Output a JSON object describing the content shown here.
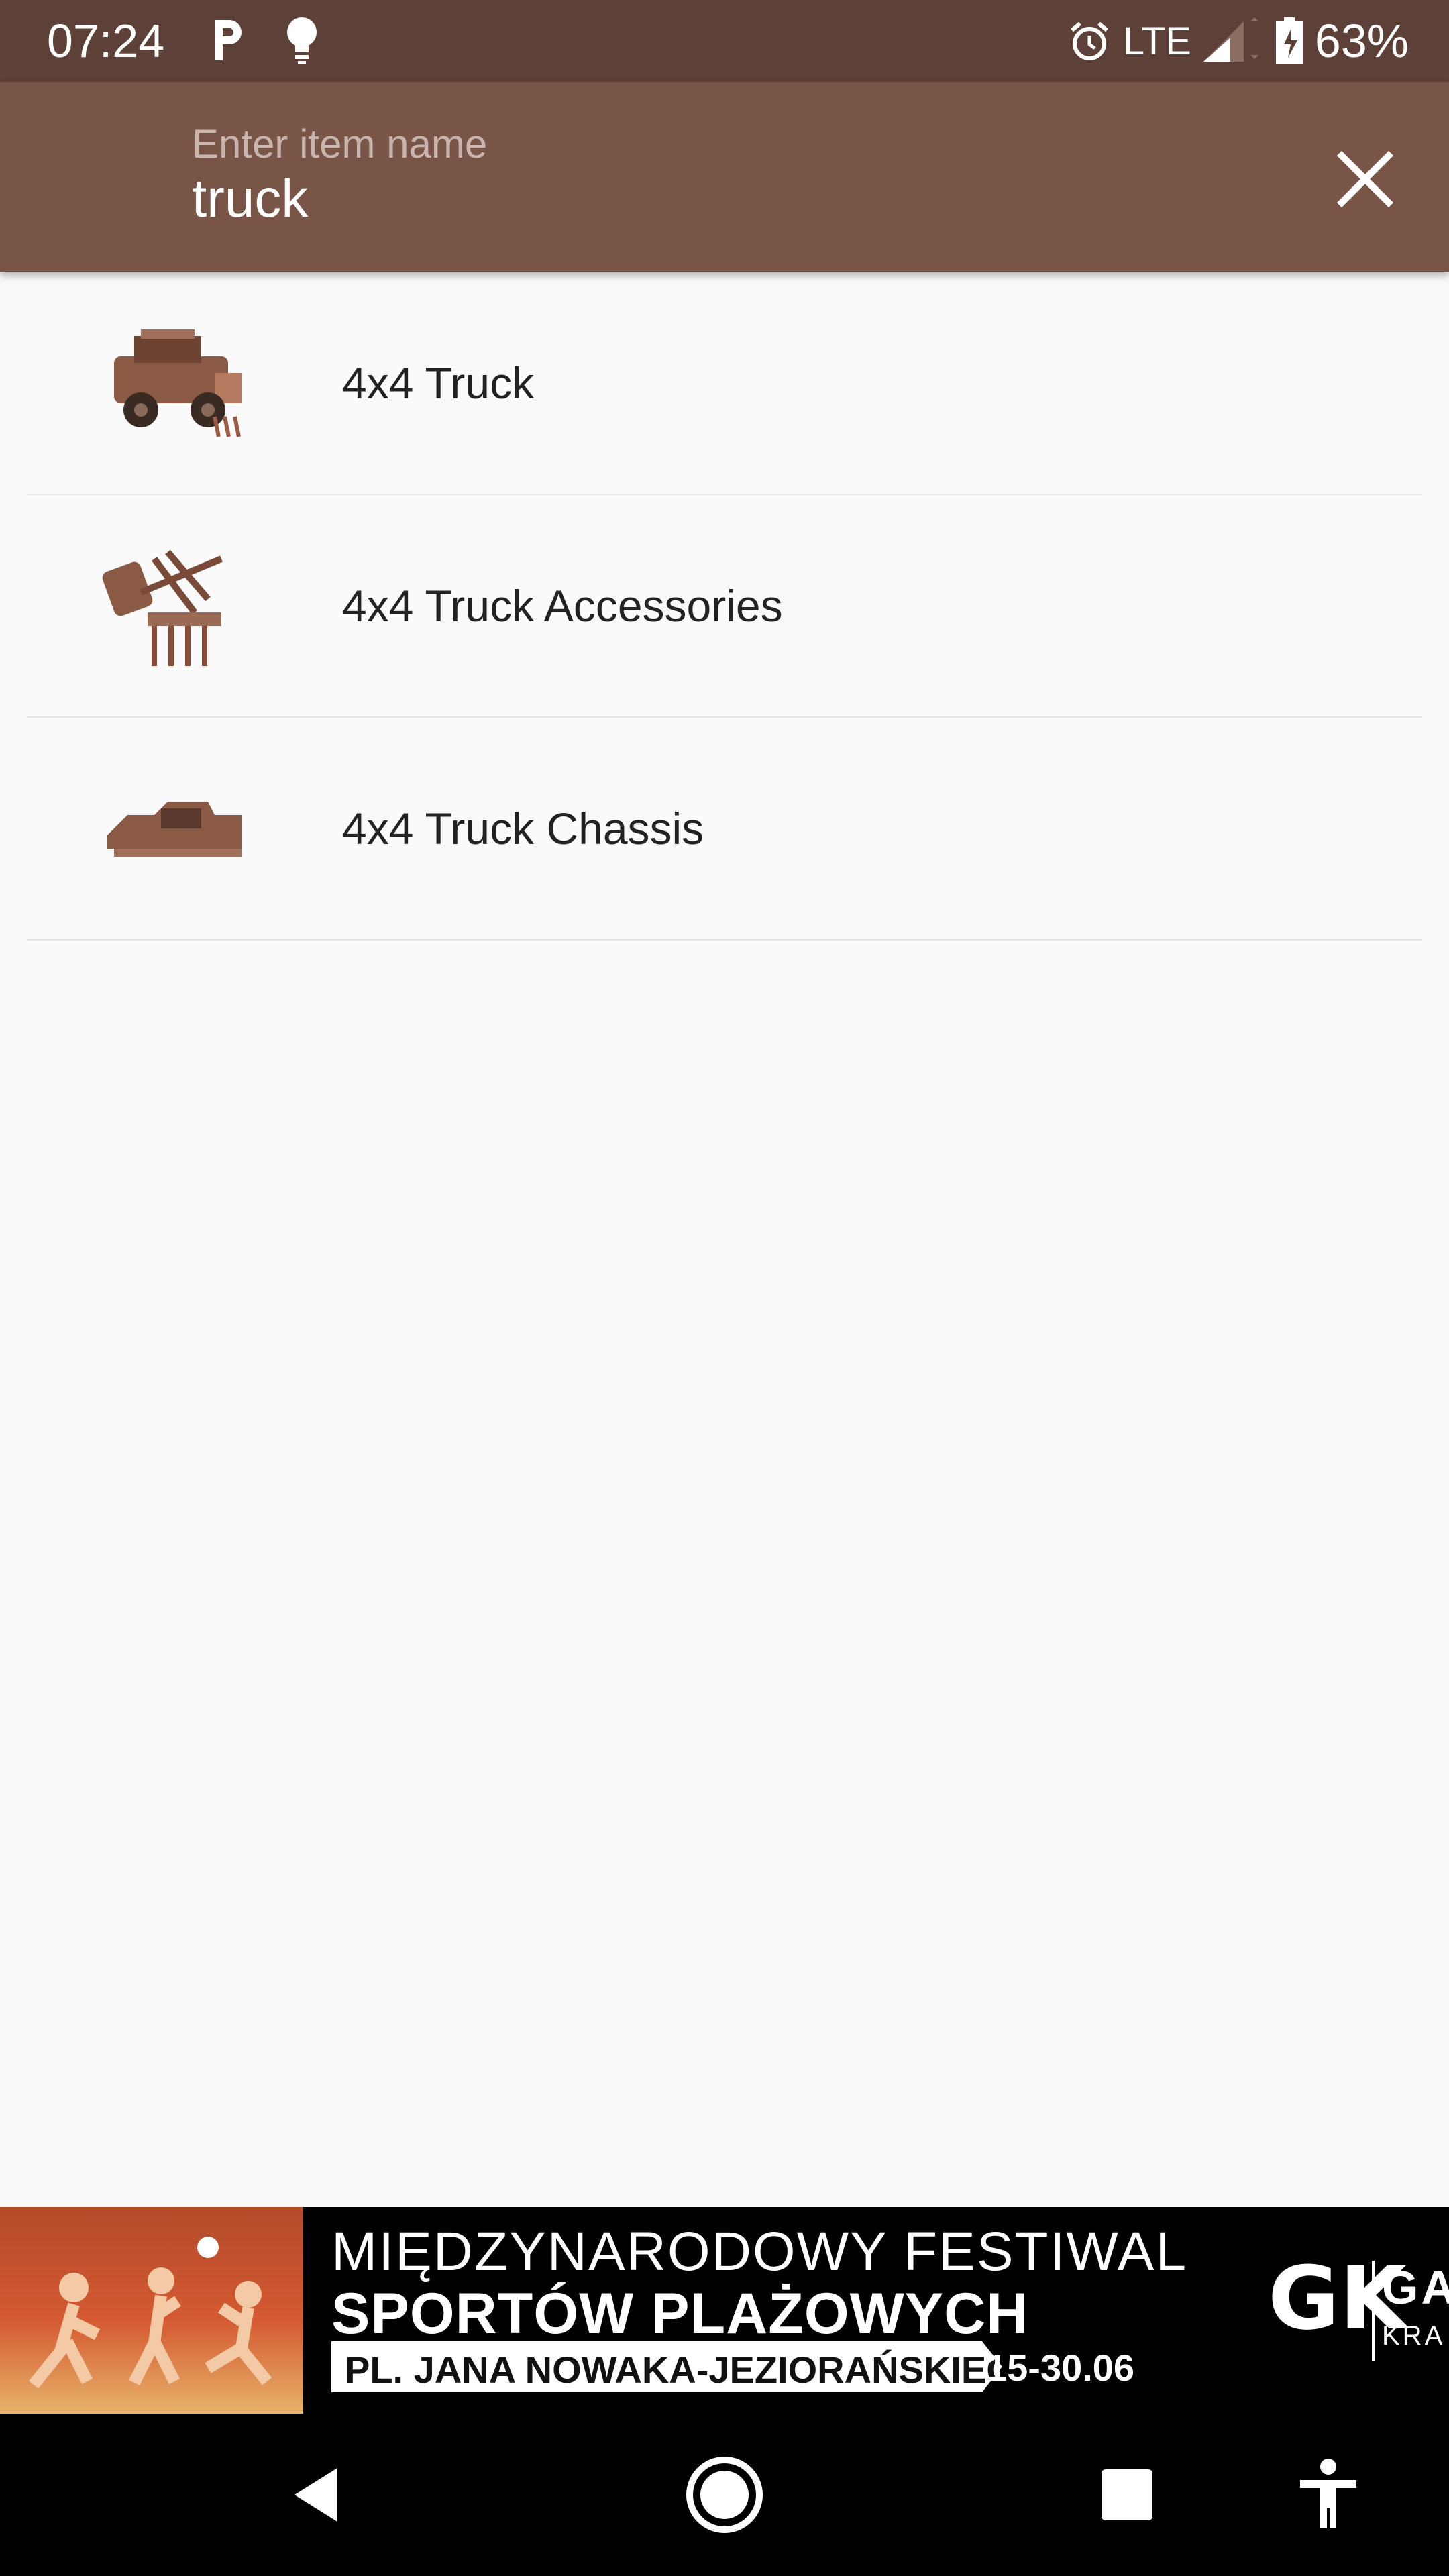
{
  "status_bar": {
    "time": "07:24",
    "left_icons": [
      "parking-icon",
      "lightbulb-icon"
    ],
    "right_icons": [
      "alarm-icon",
      "signal-icon",
      "battery-icon"
    ],
    "network": "LTE",
    "battery": "63%",
    "background": "#5d4037"
  },
  "search": {
    "placeholder": "Enter item name",
    "value": "truck",
    "close_icon": "close-icon",
    "background": "#795548"
  },
  "results": [
    {
      "name": "4x4 Truck",
      "icon": "truck-thumbnail"
    },
    {
      "name": "4x4 Truck Accessories",
      "icon": "accessories-thumbnail"
    },
    {
      "name": "4x4 Truck Chassis",
      "icon": "chassis-thumbnail"
    }
  ],
  "ad": {
    "line1": "MIĘDZYNARODOWY FESTIWAL",
    "line2": "SPORTÓW PLAŻOWYCH",
    "location": "PL. JANA NOWAKA-JEZIORAŃSKIEGO",
    "dates": "15-30.06",
    "logo": "GK",
    "logo_text": "GAL",
    "logo_sub": "KRA"
  },
  "nav_bar": {
    "buttons": [
      "back-icon",
      "home-icon",
      "recents-icon",
      "accessibility-icon"
    ]
  }
}
